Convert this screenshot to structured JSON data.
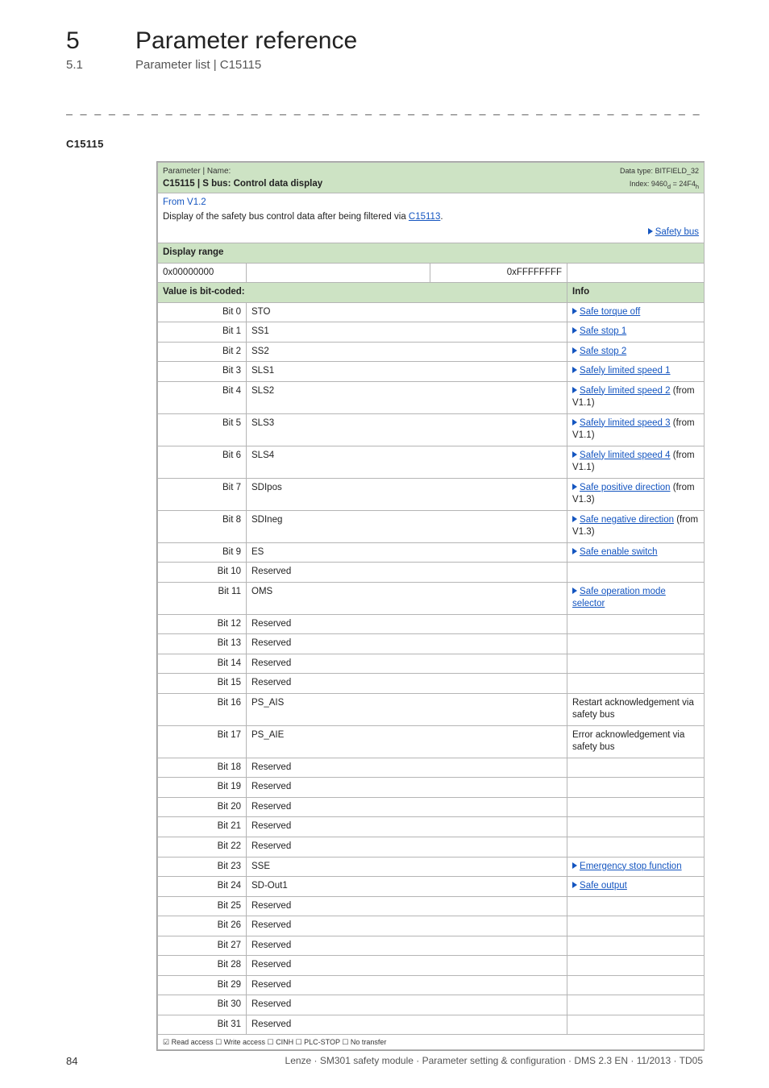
{
  "header": {
    "section_num": "5",
    "section_title": "Parameter reference",
    "sub_num": "5.1",
    "sub_title": "Parameter list | C15115"
  },
  "dashline": "_ _ _ _ _ _ _ _ _ _ _ _ _ _ _ _ _ _ _ _ _ _ _ _ _ _ _ _ _ _ _ _ _ _ _ _ _ _ _ _ _ _ _ _ _ _ _ _ _ _ _ _ _ _ _ _ _ _ _ _ _ _",
  "param_id": "C15115",
  "head_box": {
    "param_label": "Parameter | Name:",
    "param_name": "C15115 | S bus: Control data display",
    "dtype_line1": "Data type: BITFIELD_32",
    "dtype_line2_pre": "Index: 9460",
    "dtype_line2_sub1": "d",
    "dtype_line2_mid": " = 24F4",
    "dtype_line2_sub2": "h",
    "from_ver": "From V1.2",
    "desc_pre": "Display of the safety bus control data after being filtered via ",
    "desc_link": "C15113",
    "desc_post": ".",
    "safety_bus": "Safety bus"
  },
  "display_range": {
    "label": "Display range",
    "min": "0x00000000",
    "max": "0xFFFFFFFF"
  },
  "bit_header": {
    "left": "Value is bit-coded:",
    "right": "Info"
  },
  "bits": [
    {
      "bit": "Bit 0",
      "code": "STO",
      "info_type": "link",
      "info": "Safe torque off"
    },
    {
      "bit": "Bit 1",
      "code": "SS1",
      "info_type": "link",
      "info": "Safe stop 1"
    },
    {
      "bit": "Bit 2",
      "code": "SS2",
      "info_type": "link",
      "info": "Safe stop 2"
    },
    {
      "bit": "Bit 3",
      "code": "SLS1",
      "info_type": "link",
      "info": "Safely limited speed 1"
    },
    {
      "bit": "Bit 4",
      "code": "SLS2",
      "info_type": "link_suffix",
      "info": "Safely limited speed 2",
      "suffix": " (from V1.1)"
    },
    {
      "bit": "Bit 5",
      "code": "SLS3",
      "info_type": "link_suffix",
      "info": "Safely limited speed 3",
      "suffix": " (from V1.1)"
    },
    {
      "bit": "Bit 6",
      "code": "SLS4",
      "info_type": "link_suffix",
      "info": "Safely limited speed 4",
      "suffix": " (from V1.1)"
    },
    {
      "bit": "Bit 7",
      "code": "SDIpos",
      "info_type": "link_suffix",
      "info": "Safe positive direction",
      "suffix": " (from V1.3)"
    },
    {
      "bit": "Bit 8",
      "code": "SDIneg",
      "info_type": "link_suffix",
      "info": "Safe negative direction",
      "suffix": " (from V1.3)"
    },
    {
      "bit": "Bit 9",
      "code": "ES",
      "info_type": "link",
      "info": "Safe enable switch"
    },
    {
      "bit": "Bit 10",
      "code": "Reserved",
      "info_type": "none"
    },
    {
      "bit": "Bit 11",
      "code": "OMS",
      "info_type": "link",
      "info": "Safe operation mode selector"
    },
    {
      "bit": "Bit 12",
      "code": "Reserved",
      "info_type": "none"
    },
    {
      "bit": "Bit 13",
      "code": "Reserved",
      "info_type": "none"
    },
    {
      "bit": "Bit 14",
      "code": "Reserved",
      "info_type": "none"
    },
    {
      "bit": "Bit 15",
      "code": "Reserved",
      "info_type": "none"
    },
    {
      "bit": "Bit 16",
      "code": "PS_AIS",
      "info_type": "text",
      "info": "Restart acknowledgement via safety bus"
    },
    {
      "bit": "Bit 17",
      "code": "PS_AIE",
      "info_type": "text",
      "info": "Error acknowledgement via safety bus"
    },
    {
      "bit": "Bit 18",
      "code": "Reserved",
      "info_type": "none"
    },
    {
      "bit": "Bit 19",
      "code": "Reserved",
      "info_type": "none"
    },
    {
      "bit": "Bit 20",
      "code": "Reserved",
      "info_type": "none"
    },
    {
      "bit": "Bit 21",
      "code": "Reserved",
      "info_type": "none"
    },
    {
      "bit": "Bit 22",
      "code": "Reserved",
      "info_type": "none"
    },
    {
      "bit": "Bit 23",
      "code": "SSE",
      "info_type": "link",
      "info": "Emergency stop function"
    },
    {
      "bit": "Bit 24",
      "code": "SD-Out1",
      "info_type": "link",
      "info": "Safe output"
    },
    {
      "bit": "Bit 25",
      "code": "Reserved",
      "info_type": "none"
    },
    {
      "bit": "Bit 26",
      "code": "Reserved",
      "info_type": "none"
    },
    {
      "bit": "Bit 27",
      "code": "Reserved",
      "info_type": "none"
    },
    {
      "bit": "Bit 28",
      "code": "Reserved",
      "info_type": "none"
    },
    {
      "bit": "Bit 29",
      "code": "Reserved",
      "info_type": "none"
    },
    {
      "bit": "Bit 30",
      "code": "Reserved",
      "info_type": "none"
    },
    {
      "bit": "Bit 31",
      "code": "Reserved",
      "info_type": "none"
    }
  ],
  "access_line": "☑ Read access   ☐ Write access   ☐ CINH   ☐ PLC-STOP   ☐ No transfer",
  "footer": {
    "page": "84",
    "right": "Lenze · SM301 safety module · Parameter setting & configuration · DMS 2.3 EN · 11/2013 · TD05"
  }
}
